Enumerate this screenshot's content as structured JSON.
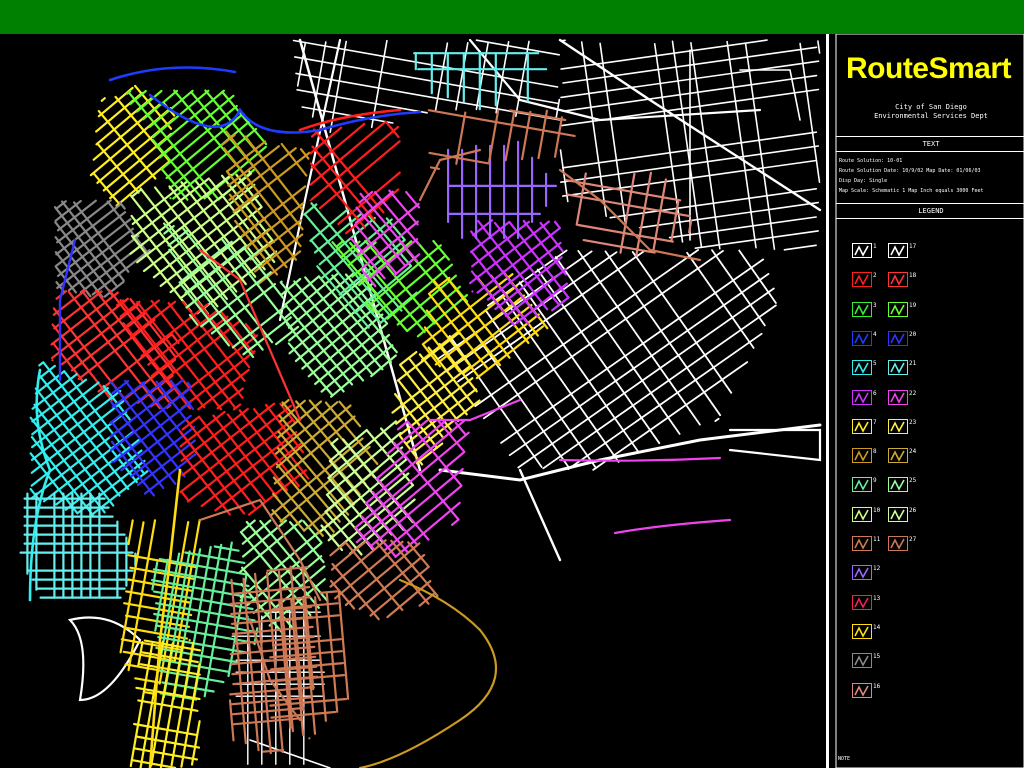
{
  "app": {
    "brand": "RouteSmart",
    "city": "City of San Diego",
    "department": "Environmental Services Dept",
    "text_header": "TEXT",
    "legend_header": "LEGEND",
    "notes": [
      "Route Solution: 10-01",
      "Route Solution Date: 10/9/02   Map Date: 01/06/03",
      "Disp Day: Single",
      "Map Scale: Schematic 1 Map Inch equals 3000 Feet"
    ],
    "footer": "NOTE"
  },
  "colors": {
    "header": "#008000",
    "brand": "#ffff00",
    "background": "#000000",
    "unassigned_streets": "#ffffff"
  },
  "legend": [
    {
      "label": "1",
      "color": "#ffffff"
    },
    {
      "label": "2",
      "color": "#ff1e1e"
    },
    {
      "label": "3",
      "color": "#33ee33"
    },
    {
      "label": "4",
      "color": "#1e3cff"
    },
    {
      "label": "5",
      "color": "#33eeee"
    },
    {
      "label": "6",
      "color": "#cc33ff"
    },
    {
      "label": "7",
      "color": "#ffee22"
    },
    {
      "label": "8",
      "color": "#cc9922"
    },
    {
      "label": "9",
      "color": "#66ee99"
    },
    {
      "label": "10",
      "color": "#ccff88"
    },
    {
      "label": "11",
      "color": "#d07a55"
    },
    {
      "label": "12",
      "color": "#9966ff"
    },
    {
      "label": "13",
      "color": "#ee2255"
    },
    {
      "label": "14",
      "color": "#ffdd11"
    },
    {
      "label": "15",
      "color": "#888888"
    },
    {
      "label": "16",
      "color": "#dd8877"
    },
    {
      "label": "17",
      "color": "#ffffff"
    },
    {
      "label": "18",
      "color": "#ff3333"
    },
    {
      "label": "19",
      "color": "#66ff33"
    },
    {
      "label": "20",
      "color": "#3333ff"
    },
    {
      "label": "21",
      "color": "#66eeee"
    },
    {
      "label": "22",
      "color": "#ee44ee"
    },
    {
      "label": "23",
      "color": "#ffee44"
    },
    {
      "label": "24",
      "color": "#ccaa33"
    },
    {
      "label": "25",
      "color": "#99ff99"
    },
    {
      "label": "26",
      "color": "#ccff99"
    },
    {
      "label": "27",
      "color": "#cc7755"
    }
  ]
}
